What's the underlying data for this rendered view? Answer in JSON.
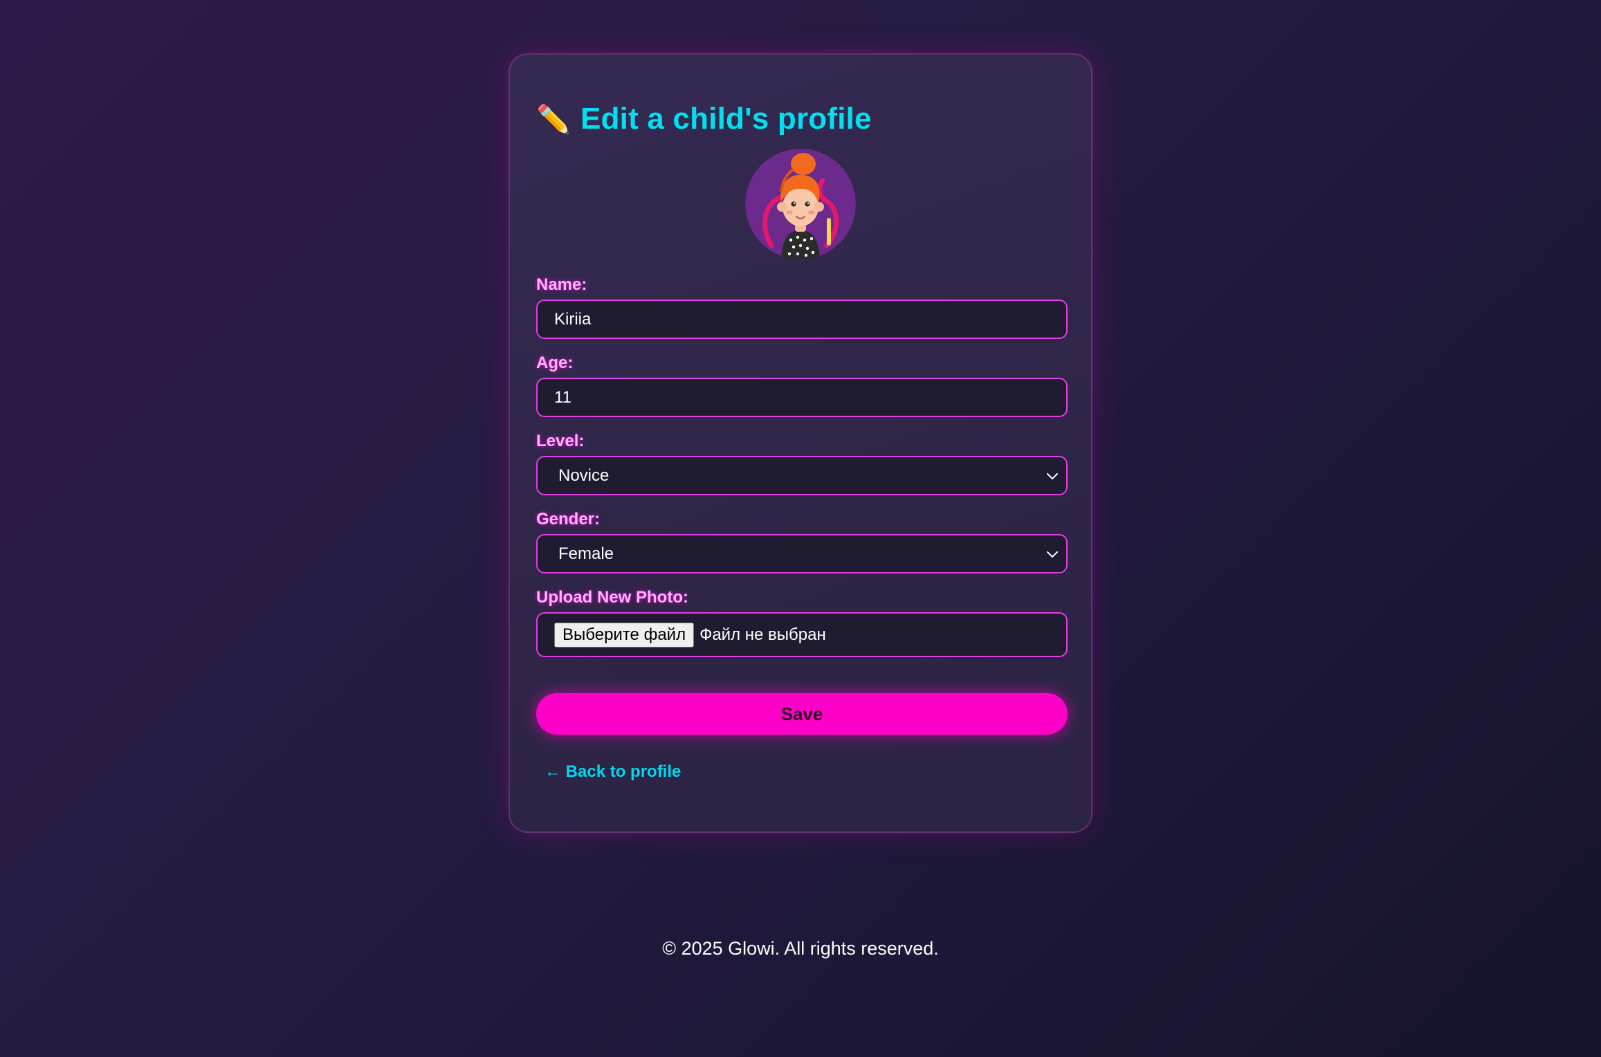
{
  "form": {
    "title": "Edit a child's profile",
    "title_icon": "pencil-icon",
    "avatar_icon": "child-avatar-illustration",
    "name": {
      "label": "Name:",
      "value": "Kiriia"
    },
    "age": {
      "label": "Age:",
      "value": "11"
    },
    "level": {
      "label": "Level:",
      "selected": "Novice"
    },
    "gender": {
      "label": "Gender:",
      "selected": "Female"
    },
    "photo": {
      "label": "Upload New Photo:",
      "button_label": "Выберите файл",
      "status": "Файл не выбран"
    },
    "save_label": "Save",
    "back_label": "← Back to profile"
  },
  "footer": {
    "text": "© 2025 Glowi. All rights reserved."
  },
  "colors": {
    "accent_pink": "#ff00c8",
    "accent_cyan": "#00e0f0",
    "label_pink": "#ffb3ff",
    "field_border": "#e63ce6",
    "field_bg": "#1f1b31"
  }
}
